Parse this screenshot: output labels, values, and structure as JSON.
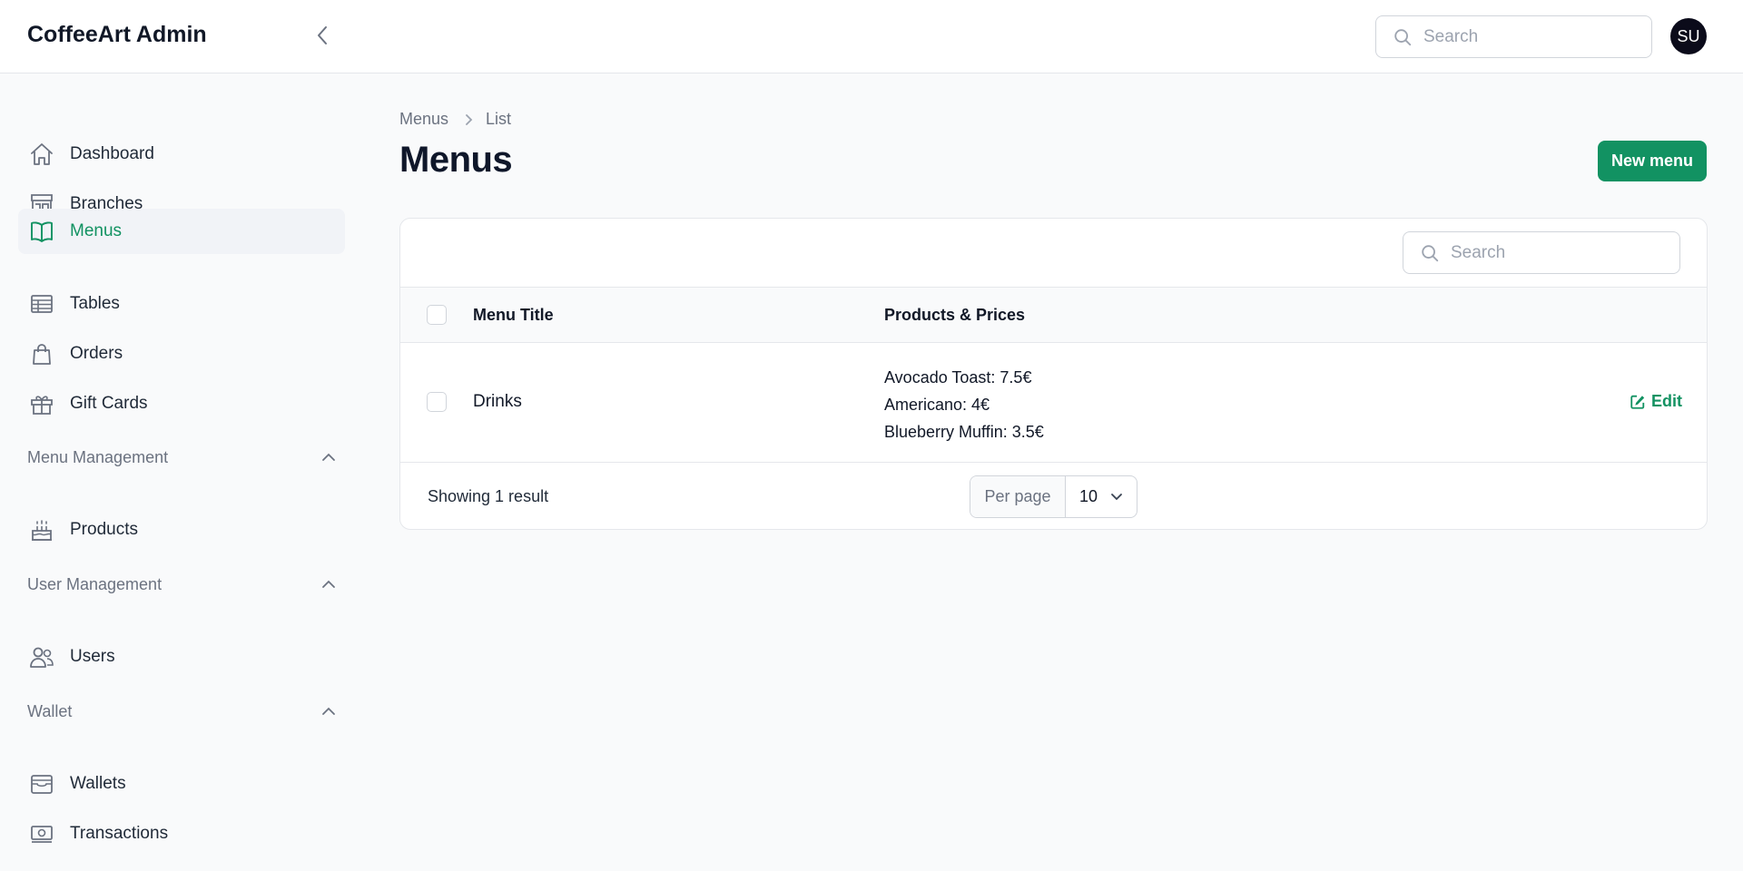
{
  "app": {
    "title": "CoffeeArt Admin"
  },
  "topbar": {
    "search_placeholder": "Search",
    "avatar_initials": "SU"
  },
  "sidebar": {
    "items": [
      {
        "label": "Dashboard",
        "icon": "home-icon",
        "active": false
      },
      {
        "label": "Branches",
        "icon": "storefront-icon",
        "active": false
      },
      {
        "label": "Menus",
        "icon": "book-open-icon",
        "active": true
      },
      {
        "label": "Tables",
        "icon": "table-icon",
        "active": false
      },
      {
        "label": "Orders",
        "icon": "shopping-bag-icon",
        "active": false
      },
      {
        "label": "Gift Cards",
        "icon": "gift-icon",
        "active": false
      }
    ],
    "groups": [
      {
        "label": "Menu Management",
        "items": [
          {
            "label": "Products",
            "icon": "cake-icon"
          }
        ]
      },
      {
        "label": "User Management",
        "items": [
          {
            "label": "Users",
            "icon": "users-icon"
          }
        ]
      },
      {
        "label": "Wallet",
        "items": [
          {
            "label": "Wallets",
            "icon": "wallet-icon"
          },
          {
            "label": "Transactions",
            "icon": "banknotes-icon"
          }
        ]
      }
    ]
  },
  "breadcrumb": {
    "items": [
      "Menus",
      "List"
    ]
  },
  "page": {
    "title": "Menus",
    "new_button": "New menu"
  },
  "table": {
    "search_placeholder": "Search",
    "columns": [
      "Menu Title",
      "Products & Prices"
    ],
    "rows": [
      {
        "title": "Drinks",
        "products": [
          "Avocado Toast: 7.5€",
          "Americano: 4€",
          "Blueberry Muffin: 3.5€"
        ],
        "action": "Edit"
      }
    ],
    "footer": {
      "showing": "Showing 1 result",
      "per_page_label": "Per page",
      "per_page_value": "10"
    }
  },
  "colors": {
    "accent": "#129262",
    "avatar_bg": "#0b0b1a"
  }
}
